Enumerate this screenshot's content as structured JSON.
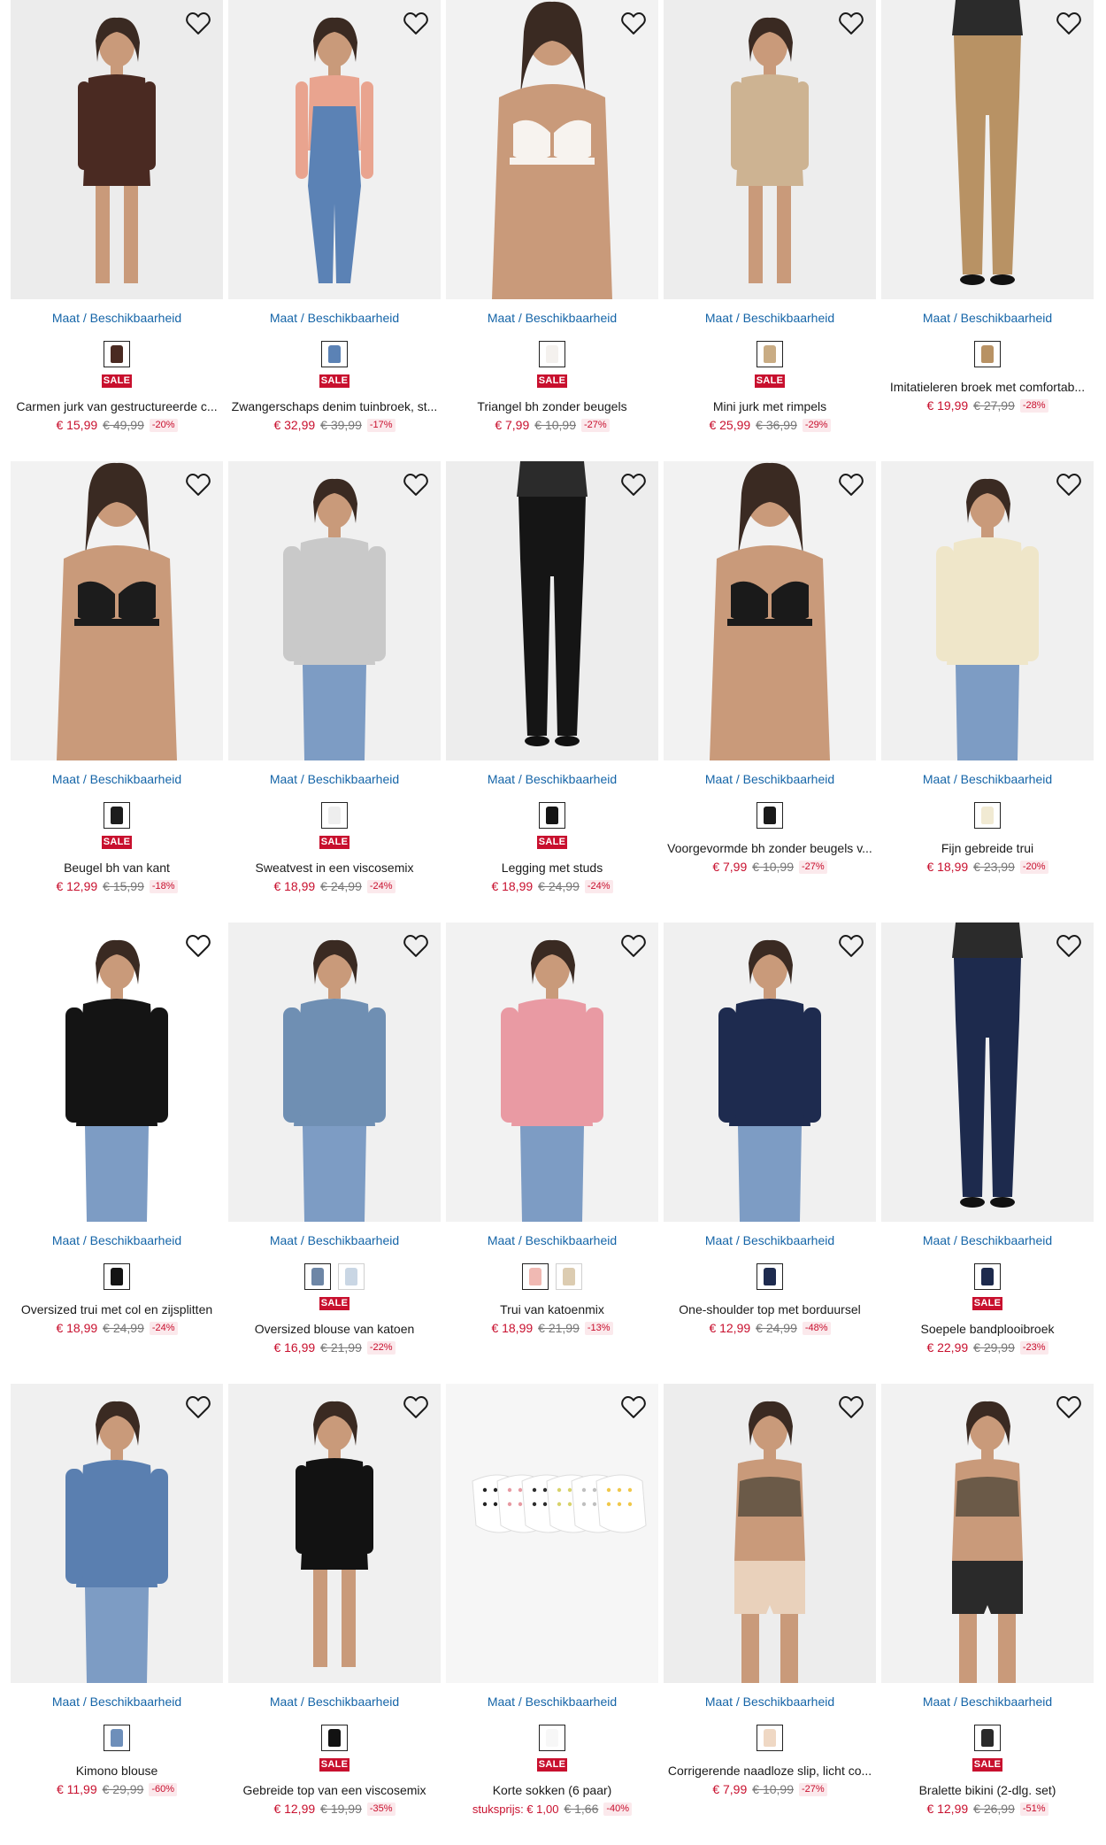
{
  "colors": {
    "link": "#1565a8",
    "sale_bg": "#c8102e",
    "price": "#c8102e",
    "old_price": "#777777"
  },
  "common": {
    "size_link": "Maat / Beschikbaarheid",
    "sale_badge": "SALE",
    "wishlist_icon": "heart-outline-icon"
  },
  "products": [
    {
      "name": "Carmen jurk van gestructureerde c...",
      "price": "€ 15,99",
      "old_price": "€ 49,99",
      "discount": "-20%",
      "sale": true,
      "swatches": [
        "#4a2a22"
      ],
      "bg": "#ececec",
      "figure": "#4a2a22",
      "kind": "dress"
    },
    {
      "name": "Zwangerschaps denim tuinbroek, st...",
      "price": "€ 32,99",
      "old_price": "€ 39,99",
      "discount": "-17%",
      "sale": true,
      "swatches": [
        "#5b82b5"
      ],
      "bg": "#f0f0f0",
      "figure": "#5b82b5",
      "kind": "overall"
    },
    {
      "name": "Triangel bh zonder beugels",
      "price": "€ 7,99",
      "old_price": "€ 10,99",
      "discount": "-27%",
      "sale": true,
      "swatches": [
        "#f4f1ee"
      ],
      "bg": "#f2f2f2",
      "figure": "#f7f3ef",
      "kind": "bra"
    },
    {
      "name": "Mini jurk met rimpels",
      "price": "€ 25,99",
      "old_price": "€ 36,99",
      "discount": "-29%",
      "sale": true,
      "swatches": [
        "#c9ac84"
      ],
      "bg": "#ededed",
      "figure": "#cdb392",
      "kind": "dress"
    },
    {
      "name": "Imitatieleren broek met comfortab...",
      "price": "€ 19,99",
      "old_price": "€ 27,99",
      "discount": "-28%",
      "sale": false,
      "swatches": [
        "#b89264"
      ],
      "bg": "#f0f0f0",
      "figure": "#b89264",
      "kind": "pants"
    },
    {
      "name": "Beugel bh van kant",
      "price": "€ 12,99",
      "old_price": "€ 15,99",
      "discount": "-18%",
      "sale": true,
      "swatches": [
        "#1c1c1c"
      ],
      "bg": "#f2f2f2",
      "figure": "#1c1c1c",
      "kind": "bra"
    },
    {
      "name": "Sweatvest in een viscosemix",
      "price": "€ 18,99",
      "old_price": "€ 24,99",
      "discount": "-24%",
      "sale": true,
      "swatches": [
        "#eeeeee"
      ],
      "bg": "#f0f0f0",
      "figure": "#c9c9c9",
      "kind": "top"
    },
    {
      "name": "Legging met studs",
      "price": "€ 18,99",
      "old_price": "€ 24,99",
      "discount": "-24%",
      "sale": true,
      "swatches": [
        "#151515"
      ],
      "bg": "#ededed",
      "figure": "#151515",
      "kind": "pants"
    },
    {
      "name": "Voorgevormde bh zonder beugels v...",
      "price": "€ 7,99",
      "old_price": "€ 10,99",
      "discount": "-27%",
      "sale": false,
      "swatches": [
        "#1a1a1a"
      ],
      "bg": "#f2f2f2",
      "figure": "#1a1a1a",
      "kind": "bra"
    },
    {
      "name": "Fijn gebreide trui",
      "price": "€ 18,99",
      "old_price": "€ 23,99",
      "discount": "-20%",
      "sale": false,
      "swatches": [
        "#f1ead3"
      ],
      "bg": "#f0f0f0",
      "figure": "#efe6c9",
      "kind": "top"
    },
    {
      "name": "Oversized trui met col en zijsplitten",
      "price": "€ 18,99",
      "old_price": "€ 24,99",
      "discount": "-24%",
      "sale": false,
      "swatches": [
        "#141414"
      ],
      "bg": "#ffffff",
      "figure": "#141414",
      "kind": "top"
    },
    {
      "name": "Oversized blouse van katoen",
      "price": "€ 16,99",
      "old_price": "€ 21,99",
      "discount": "-22%",
      "sale": true,
      "swatches": [
        "#6d86a6",
        "#c9d6e4"
      ],
      "bg": "#f0f0f0",
      "figure": "#6f8fb3",
      "kind": "top"
    },
    {
      "name": "Trui van katoenmix",
      "price": "€ 18,99",
      "old_price": "€ 21,99",
      "discount": "-13%",
      "sale": false,
      "swatches": [
        "#f0b9b3",
        "#dcccb1"
      ],
      "bg": "#f2f2f2",
      "figure": "#e99aa3",
      "kind": "top"
    },
    {
      "name": "One-shoulder top met borduursel",
      "price": "€ 12,99",
      "old_price": "€ 24,99",
      "discount": "-48%",
      "sale": false,
      "swatches": [
        "#1e2b4f"
      ],
      "bg": "#f0f0f0",
      "figure": "#1e2b4f",
      "kind": "top"
    },
    {
      "name": "Soepele bandplooibroek",
      "price": "€ 22,99",
      "old_price": "€ 29,99",
      "discount": "-23%",
      "sale": true,
      "swatches": [
        "#1d2a4d"
      ],
      "bg": "#f0f0f0",
      "figure": "#1d2a4d",
      "kind": "pants"
    },
    {
      "name": "Kimono blouse",
      "price": "€ 11,99",
      "old_price": "€ 29,99",
      "discount": "-60%",
      "sale": false,
      "swatches": [
        "#6e8fba"
      ],
      "bg": "#f0f0f0",
      "figure": "#5a7fb0",
      "kind": "top"
    },
    {
      "name": "Gebreide top van een viscosemix",
      "price": "€ 12,99",
      "old_price": "€ 19,99",
      "discount": "-35%",
      "sale": true,
      "swatches": [
        "#121212"
      ],
      "bg": "#f0f0f0",
      "figure": "#121212",
      "kind": "dress"
    },
    {
      "name": "Korte sokken (6 paar)",
      "price": "stuksprijs: € 1,00",
      "old_price": "€ 1,66",
      "discount": "-40%",
      "sale": true,
      "swatches": [
        "#f7f7f7"
      ],
      "bg": "#f6f6f6",
      "figure": "#ffffff",
      "kind": "socks"
    },
    {
      "name": "Corrigerende naadloze slip, licht co...",
      "price": "€ 7,99",
      "old_price": "€ 10,99",
      "discount": "-27%",
      "sale": false,
      "swatches": [
        "#efd8c4"
      ],
      "bg": "#ededed",
      "figure": "#e9d1bb",
      "kind": "brief"
    },
    {
      "name": "Bralette bikini (2-dlg. set)",
      "price": "€ 12,99",
      "old_price": "€ 26,99",
      "discount": "-51%",
      "sale": true,
      "swatches": [
        "#2a2a2a"
      ],
      "bg": "#f2f2f2",
      "figure": "#2a2a2a",
      "kind": "brief"
    }
  ]
}
